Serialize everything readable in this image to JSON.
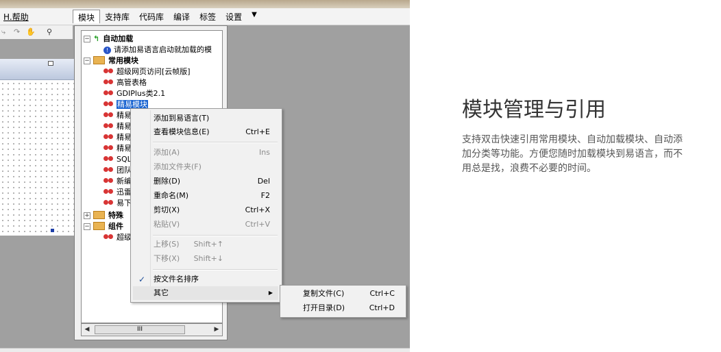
{
  "menubar": {
    "help_label": "H.帮助",
    "tabs": [
      "模块",
      "支持库",
      "代码库",
      "编译",
      "标签",
      "设置"
    ],
    "dropdown_symbol": "▼"
  },
  "toolbar": {
    "icons": [
      "redo-icon",
      "hand-icon",
      "binoculars-icon"
    ]
  },
  "tree": {
    "groups": [
      {
        "label": "自动加载",
        "state": "expanded"
      },
      {
        "label": "常用模块",
        "state": "expanded"
      },
      {
        "label": "特殊",
        "state": "collapsed"
      },
      {
        "label": "组件",
        "state": "expanded"
      }
    ],
    "autoload_item": "请添加易语言启动就加载的模",
    "common_items": [
      "超级网页访问[云帧版]",
      "高管表格",
      "GDIPlus类2.1",
      "精易模块",
      "精易",
      "精易",
      "精易",
      "精易",
      "SQL",
      "团队",
      "新编",
      "迅雷",
      "易下"
    ],
    "component_items": [
      "超级"
    ],
    "scroll_thumb_text": "III"
  },
  "context_menu": {
    "items": [
      {
        "label": "添加到易语言(T)",
        "shortcut": "",
        "disabled": false
      },
      {
        "label": "查看模块信息(E)",
        "shortcut": "Ctrl+E",
        "disabled": false
      },
      {
        "label": "添加(A)",
        "shortcut": "Ins",
        "disabled": true
      },
      {
        "label": "添加文件夹(F)",
        "shortcut": "",
        "disabled": true
      },
      {
        "label": "删除(D)",
        "shortcut": "Del",
        "disabled": false
      },
      {
        "label": "重命名(M)",
        "shortcut": "F2",
        "disabled": false
      },
      {
        "label": "剪切(X)",
        "shortcut": "Ctrl+X",
        "disabled": false
      },
      {
        "label": "粘贴(V)",
        "shortcut": "Ctrl+V",
        "disabled": true
      },
      {
        "label": "上移(S)",
        "shortcut": "Shift+↑",
        "disabled": true
      },
      {
        "label": "下移(X)",
        "shortcut": "Shift+↓",
        "disabled": true
      },
      {
        "label": "按文件名排序",
        "shortcut": "",
        "disabled": false,
        "checked": true
      },
      {
        "label": "其它",
        "shortcut": "",
        "disabled": false,
        "has_submenu": true
      }
    ],
    "check_symbol": "✓",
    "submenu_symbol": "▶"
  },
  "submenu": {
    "items": [
      {
        "label": "复制文件(C)",
        "shortcut": "Ctrl+C"
      },
      {
        "label": "打开目录(D)",
        "shortcut": "Ctrl+D"
      }
    ]
  },
  "feature": {
    "title": "模块管理与引用",
    "description": "支持双击快速引用常用模块、自动加载模块、自动添加分类等功能。方便您随时加载模块到易语言，而不用总是找，浪费不必要的时间。"
  },
  "colors": {
    "selection": "#1b65d1",
    "folder": "#e9b352",
    "module_icon": "#d83535",
    "workspace": "#a0a0a0"
  }
}
